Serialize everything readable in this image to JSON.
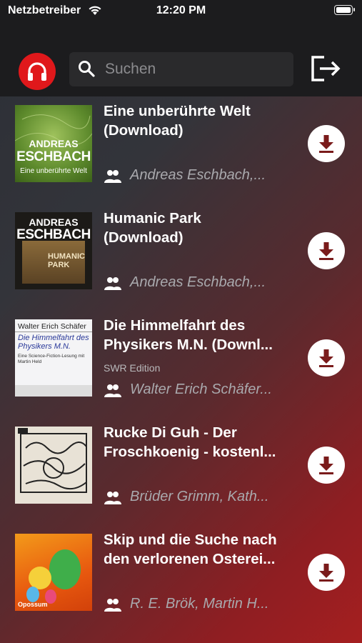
{
  "status_bar": {
    "carrier": "Netzbetreiber",
    "time": "12:20 PM"
  },
  "search": {
    "placeholder": "Suchen",
    "value": ""
  },
  "colors": {
    "accent": "#e0181b",
    "header_bg": "#1c1c1e"
  },
  "items": [
    {
      "title1": "Eine unberührte Welt",
      "title2": "(Download)",
      "subtitle": "",
      "author": "Andreas Eschbach,...",
      "cover": {
        "line1": "ANDREAS",
        "line2": "ESCHBACH",
        "line3": "Eine unberührte Welt"
      }
    },
    {
      "title1": "Humanic Park",
      "title2": "(Download)",
      "subtitle": "",
      "author": "Andreas Eschbach,...",
      "cover": {
        "line1": "ANDREAS",
        "line2": "ESCHBACH",
        "line3": "HUMANIC PARK"
      }
    },
    {
      "title1": "Die Himmelfahrt des",
      "title2": "Physikers M.N. (Downl...",
      "subtitle": "SWR Edition",
      "author": "Walter Erich Schäfer...",
      "cover": {
        "line1": "Walter Erich Schäfer",
        "line2": "Die Himmelfahrt des Physikers M.N.",
        "line3": "Eine Science-Fiction-Lesung mit Martin Held"
      }
    },
    {
      "title1": "Rucke Di Guh - Der",
      "title2": "Froschkoenig - kostenl...",
      "subtitle": "",
      "author": "Brüder Grimm, Kath...",
      "cover": {
        "line1": "",
        "line2": "",
        "line3": ""
      }
    },
    {
      "title1": "Skip und die Suche nach",
      "title2": "den verlorenen Osterei...",
      "subtitle": "",
      "author": "R. E. Brök, Martin H...",
      "cover": {
        "line1": "",
        "line2": "",
        "line3": "Opossum"
      }
    }
  ]
}
